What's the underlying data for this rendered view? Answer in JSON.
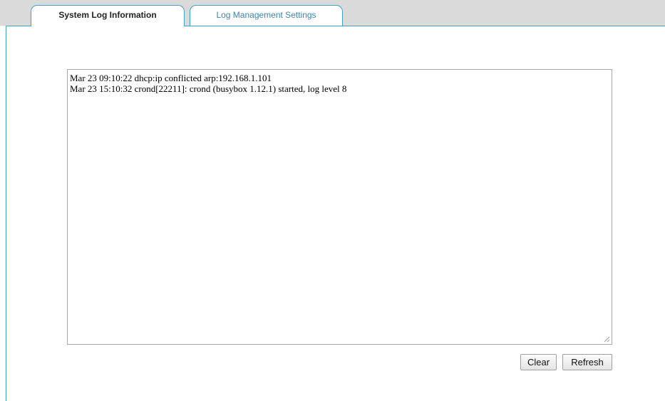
{
  "tabs": [
    {
      "label": "System Log Information",
      "active": true
    },
    {
      "label": "Log Management Settings",
      "active": false
    }
  ],
  "log": {
    "lines": [
      "Mar 23 09:10:22 dhcp:ip conflicted arp:192.168.1.101",
      "Mar 23 15:10:32 crond[22211]: crond (busybox 1.12.1) started, log level 8"
    ]
  },
  "buttons": {
    "clear_label": "Clear",
    "refresh_label": "Refresh"
  },
  "colors": {
    "accent_border": "#3fa3c6",
    "tab_bar_background": "#dadada",
    "inactive_tab_text": "#3b86a8"
  }
}
